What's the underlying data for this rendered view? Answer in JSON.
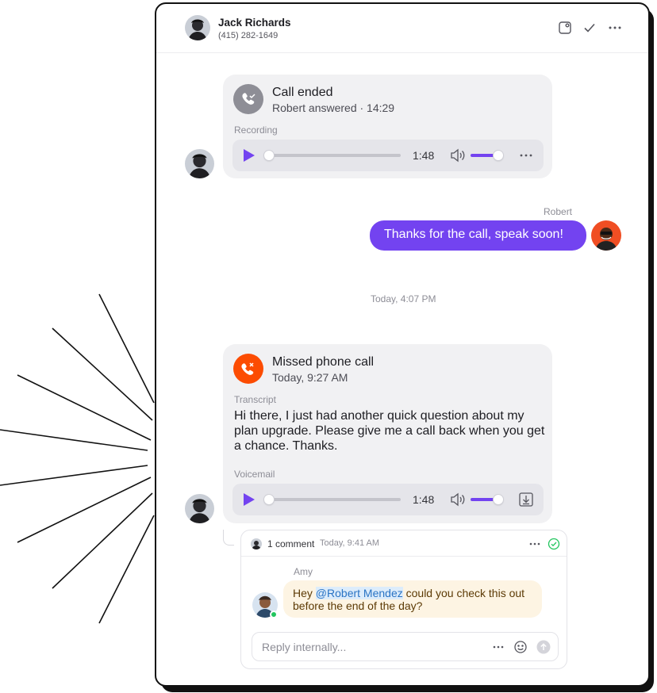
{
  "contact": {
    "name": "Jack Richards",
    "phone": "(415) 282-1649"
  },
  "header_icons": [
    "contact-card-icon",
    "check-icon",
    "more-icon"
  ],
  "call_ended": {
    "title": "Call ended",
    "subtitle": "Robert answered · 14:29",
    "recording_label": "Recording",
    "duration": "1:48",
    "progress": 0.0,
    "volume": 0.8
  },
  "outgoing": {
    "sender": "Robert",
    "text": "Thanks for the call, speak soon!"
  },
  "divider": "Today, 4:07 PM",
  "missed_call": {
    "title": "Missed phone call",
    "subtitle": "Today, 9:27 AM",
    "transcript_label": "Transcript",
    "transcript": "Hi there, I just had another quick question about my plan upgrade. Please give me a call back when you get a chance. Thanks.",
    "voicemail_label": "Voicemail",
    "duration": "1:48",
    "progress": 0.0,
    "volume": 0.8
  },
  "comments": {
    "count_label": "1 comment",
    "timestamp": "Today, 9:41 AM",
    "author": "Amy",
    "text_before": "Hey ",
    "mention": "@Robert Mendez",
    "text_after": " could you check this out before the end of the day?",
    "reply_placeholder": "Reply internally..."
  },
  "colors": {
    "accent": "#7343f0",
    "missed": "#fc4c02",
    "call_icon_bg": "#8e8e96",
    "comment_bg": "#fdf4e3",
    "mention": "#2a74c4",
    "online": "#22c55e"
  }
}
